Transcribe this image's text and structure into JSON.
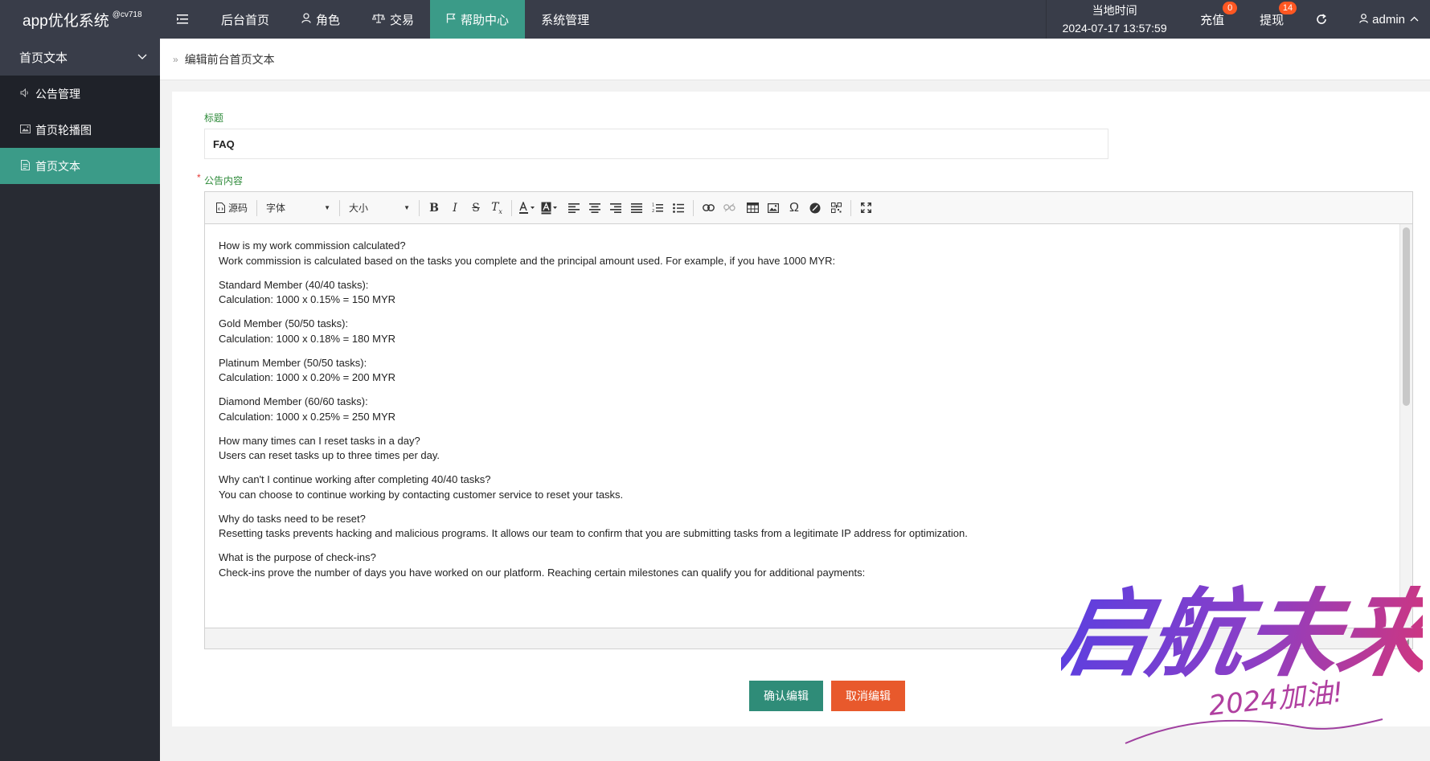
{
  "app": {
    "title": "app优化系统",
    "version": "@cv718"
  },
  "topnav": {
    "menu_toggle_icon": "menu-fold-icon",
    "items": [
      {
        "label": "后台首页",
        "icon": ""
      },
      {
        "label": "角色",
        "icon": "user-icon"
      },
      {
        "label": "交易",
        "icon": "scale-icon"
      },
      {
        "label": "帮助中心",
        "icon": "flag-icon",
        "active": true
      },
      {
        "label": "系统管理",
        "icon": ""
      }
    ]
  },
  "header_right": {
    "time_label": "当地时间",
    "time_value": "2024-07-17 13:57:59",
    "recharge": {
      "label": "充值",
      "badge": "0"
    },
    "withdraw": {
      "label": "提现",
      "badge": "14"
    },
    "refresh_icon": "refresh-icon",
    "user": {
      "name": "admin"
    }
  },
  "sidebar": {
    "group": "首页文本",
    "items": [
      {
        "label": "公告管理",
        "icon": "speaker-icon"
      },
      {
        "label": "首页轮播图",
        "icon": "image-icon"
      },
      {
        "label": "首页文本",
        "icon": "document-icon",
        "active": true
      }
    ]
  },
  "breadcrumb": {
    "current": "编辑前台首页文本"
  },
  "form": {
    "title_label": "标题",
    "title_value": "FAQ",
    "content_label": "公告内容",
    "toolbar": {
      "source": "源码",
      "font": "字体",
      "size": "大小"
    },
    "content_lines": [
      [
        "How is my work commission calculated?",
        "Work commission is calculated based on the tasks you complete and the principal amount used. For example, if you have 1000 MYR:"
      ],
      [
        "Standard Member (40/40 tasks):",
        "Calculation: 1000 x 0.15% = 150 MYR"
      ],
      [
        "Gold Member (50/50 tasks):",
        "Calculation: 1000 x 0.18% = 180 MYR"
      ],
      [
        "Platinum Member (50/50 tasks):",
        "Calculation: 1000 x 0.20% = 200 MYR"
      ],
      [
        "Diamond Member (60/60 tasks):",
        "Calculation: 1000 x 0.25% = 250 MYR"
      ],
      [
        "How many times can I reset tasks in a day?",
        "Users can reset tasks up to three times per day."
      ],
      [
        "Why can't I continue working after completing 40/40 tasks?",
        "You can choose to continue working by contacting customer service to reset your tasks."
      ],
      [
        "Why do tasks need to be reset?",
        "Resetting tasks prevents hacking and malicious programs. It allows our team to confirm that you are submitting tasks from a legitimate IP address for optimization."
      ],
      [
        "What is the purpose of check-ins?",
        "Check-ins prove the number of days you have worked on our platform. Reaching certain milestones can qualify you for additional payments:"
      ]
    ],
    "confirm_label": "确认编辑",
    "cancel_label": "取消编辑"
  },
  "watermark": {
    "text_main": "启航未来",
    "text_sub": "2024加油!"
  },
  "colors": {
    "topbar": "#393d49",
    "sidebar": "#282b33",
    "accent": "#3b9b88",
    "cancel": "#e8592c",
    "badge": "#ff5722",
    "label_green": "#2e8b3a"
  }
}
